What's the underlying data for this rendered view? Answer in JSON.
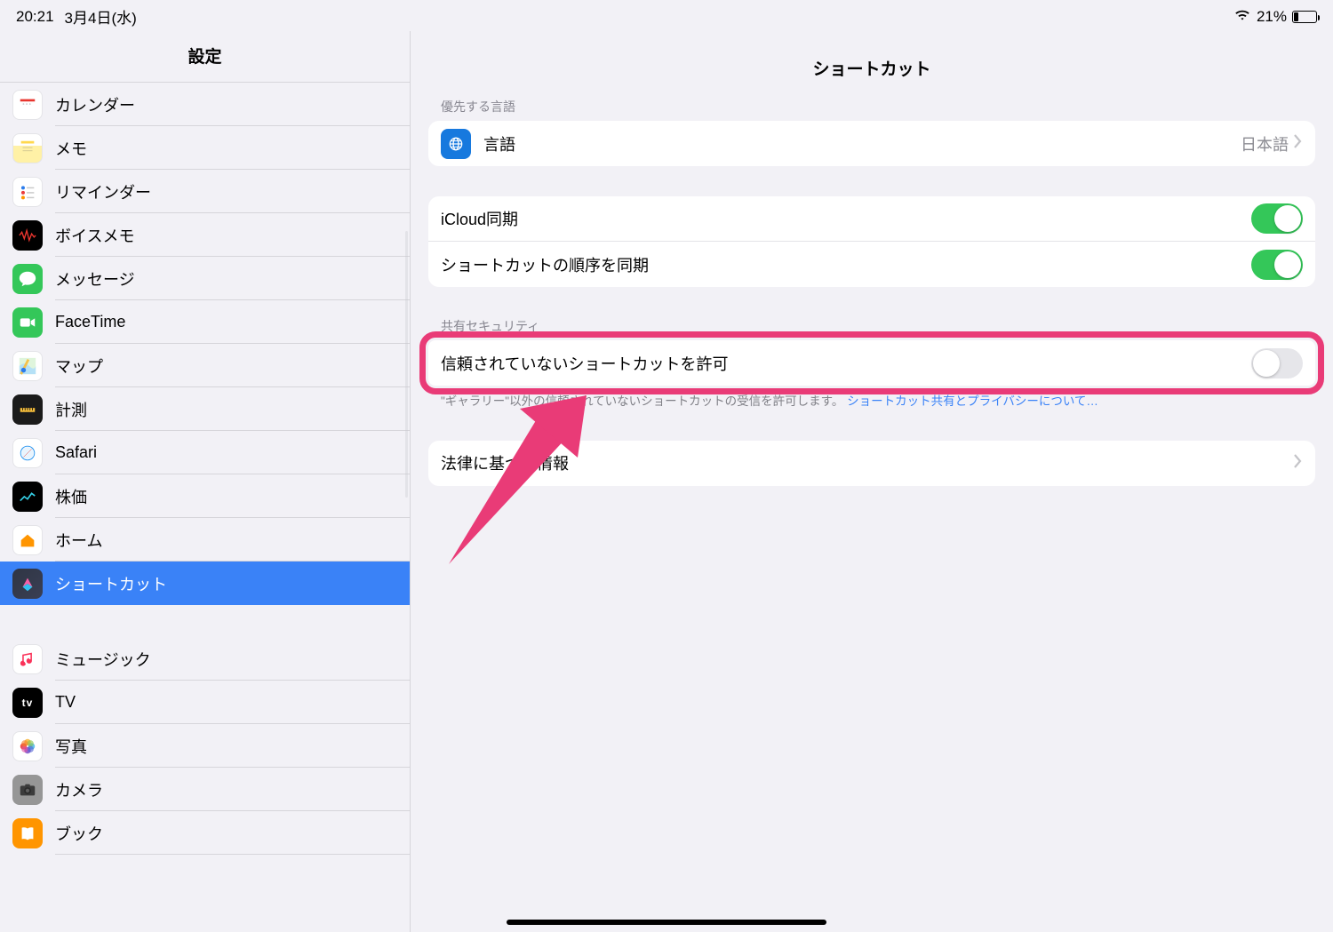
{
  "status": {
    "time": "20:21",
    "date": "3月4日(水)",
    "battery_text": "21%"
  },
  "sidebar": {
    "title": "設定",
    "items": {
      "calendar": "カレンダー",
      "notes": "メモ",
      "reminders": "リマインダー",
      "voicememo": "ボイスメモ",
      "messages": "メッセージ",
      "facetime": "FaceTime",
      "maps": "マップ",
      "measure": "計測",
      "safari": "Safari",
      "stocks": "株価",
      "home": "ホーム",
      "shortcuts": "ショートカット",
      "music": "ミュージック",
      "tv": "TV",
      "photos": "写真",
      "camera": "カメラ",
      "books": "ブック"
    }
  },
  "detail": {
    "title": "ショートカット",
    "lang_group": {
      "title": "優先する言語",
      "label": "言語",
      "value": "日本語"
    },
    "sync_group": {
      "icloud": "iCloud同期",
      "order": "ショートカットの順序を同期"
    },
    "security_group": {
      "title": "共有セキュリティ",
      "untrusted": "信頼されていないショートカットを許可",
      "footer_text": "\"ギャラリー\"以外の信頼されていないショートカットの受信を許可します。",
      "footer_link": "ショートカット共有とプライバシーについて…"
    },
    "legal": {
      "label": "法律に基づく情報"
    }
  }
}
